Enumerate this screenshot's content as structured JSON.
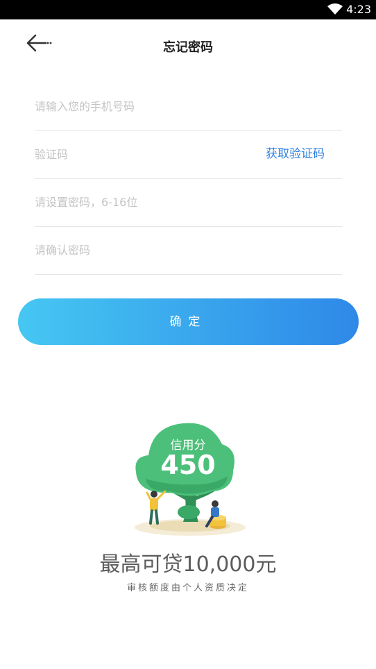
{
  "status_bar": {
    "time": "4:23",
    "wifi_icon": "wifi-icon"
  },
  "nav": {
    "back_icon": "arrow-left-icon",
    "title": "忘记密码"
  },
  "form": {
    "phone_placeholder": "请输入您的手机号码",
    "code_placeholder": "验证码",
    "get_code_label": "获取验证码",
    "password_placeholder": "请设置密码，6-16位",
    "confirm_password_placeholder": "请确认密码"
  },
  "confirm_button": {
    "label": "确定"
  },
  "promo": {
    "tree_label": "信用分",
    "score": "450",
    "headline": "最高可贷10,000元",
    "subline": "审核额度由个人资质决定"
  },
  "colors": {
    "accent_blue": "#2f80e0",
    "button_gradient_start": "#46c7f2",
    "button_gradient_end": "#2e88e8",
    "tree_green": "#4cc07a"
  }
}
